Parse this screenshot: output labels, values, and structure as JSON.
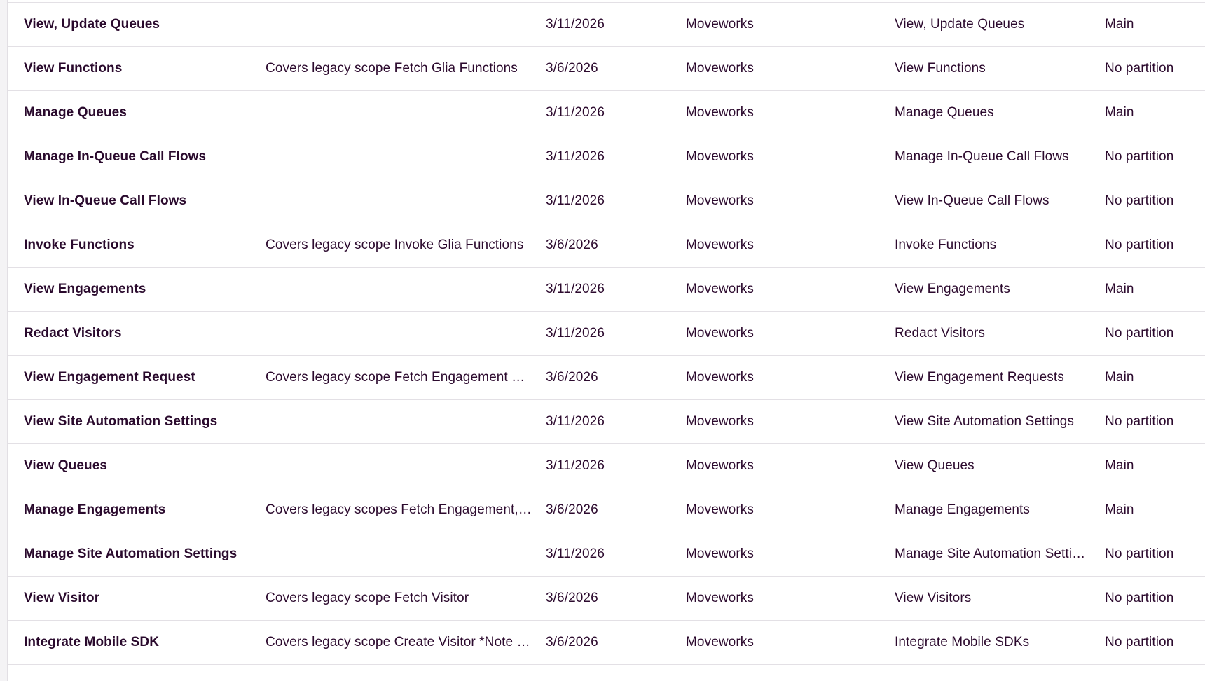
{
  "colors": {
    "text": "#2c0a2e",
    "row_border": "#e3e0e5",
    "background": "#ffffff"
  },
  "table": {
    "rows": [
      {
        "name": "View, Update Queues",
        "description": "",
        "date": "3/11/2026",
        "organization": "Moveworks",
        "scope": "View, Update Queues",
        "partition": "Main"
      },
      {
        "name": "View Functions",
        "description": "Covers legacy scope Fetch Glia Functions",
        "date": "3/6/2026",
        "organization": "Moveworks",
        "scope": "View Functions",
        "partition": "No partition"
      },
      {
        "name": "Manage Queues",
        "description": "",
        "date": "3/11/2026",
        "organization": "Moveworks",
        "scope": "Manage Queues",
        "partition": "Main"
      },
      {
        "name": "Manage In-Queue Call Flows",
        "description": "",
        "date": "3/11/2026",
        "organization": "Moveworks",
        "scope": "Manage In-Queue Call Flows",
        "partition": "No partition"
      },
      {
        "name": "View In-Queue Call Flows",
        "description": "",
        "date": "3/11/2026",
        "organization": "Moveworks",
        "scope": "View In-Queue Call Flows",
        "partition": "No partition"
      },
      {
        "name": "Invoke Functions",
        "description": "Covers legacy scope Invoke Glia Functions",
        "date": "3/6/2026",
        "organization": "Moveworks",
        "scope": "Invoke Functions",
        "partition": "No partition"
      },
      {
        "name": "View Engagements",
        "description": "",
        "date": "3/11/2026",
        "organization": "Moveworks",
        "scope": "View Engagements",
        "partition": "Main"
      },
      {
        "name": "Redact Visitors",
        "description": "",
        "date": "3/11/2026",
        "organization": "Moveworks",
        "scope": "Redact Visitors",
        "partition": "No partition"
      },
      {
        "name": "View Engagement Request",
        "description": "Covers legacy scope Fetch Engagement R…",
        "date": "3/6/2026",
        "organization": "Moveworks",
        "scope": "View Engagement Requests",
        "partition": "Main"
      },
      {
        "name": "View Site Automation Settings",
        "description": "",
        "date": "3/11/2026",
        "organization": "Moveworks",
        "scope": "View Site Automation Settings",
        "partition": "No partition"
      },
      {
        "name": "View Queues",
        "description": "",
        "date": "3/11/2026",
        "organization": "Moveworks",
        "scope": "View Queues",
        "partition": "Main"
      },
      {
        "name": "Manage Engagements",
        "description": "Covers legacy scopes Fetch Engagement, …",
        "date": "3/6/2026",
        "organization": "Moveworks",
        "scope": "Manage Engagements",
        "partition": "Main"
      },
      {
        "name": "Manage Site Automation Settings",
        "description": "",
        "date": "3/11/2026",
        "organization": "Moveworks",
        "scope": "Manage Site Automation Setti…",
        "partition": "No partition"
      },
      {
        "name": "View Visitor",
        "description": "Covers legacy scope Fetch Visitor",
        "date": "3/6/2026",
        "organization": "Moveworks",
        "scope": "View Visitors",
        "partition": "No partition"
      },
      {
        "name": "Integrate Mobile SDK",
        "description": "Covers legacy scope Create Visitor *Note …",
        "date": "3/6/2026",
        "organization": "Moveworks",
        "scope": "Integrate Mobile SDKs",
        "partition": "No partition"
      }
    ]
  }
}
